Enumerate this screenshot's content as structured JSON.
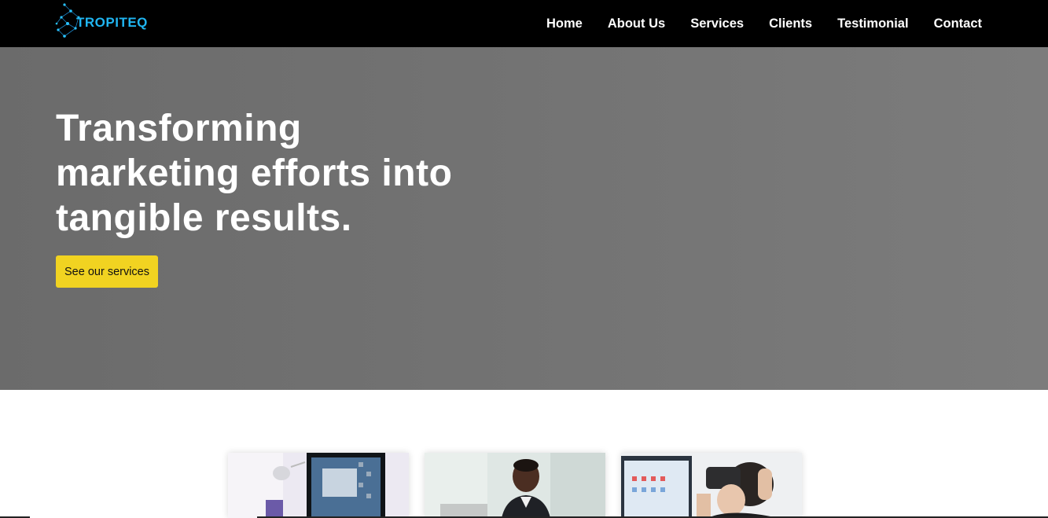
{
  "brand": {
    "name": "TROPITEQ"
  },
  "nav": {
    "items": [
      {
        "label": "Home"
      },
      {
        "label": "About Us"
      },
      {
        "label": "Services"
      },
      {
        "label": "Clients"
      },
      {
        "label": "Testimonial"
      },
      {
        "label": "Contact"
      }
    ]
  },
  "hero": {
    "title_lines": [
      "Transforming",
      "marketing efforts into",
      "tangible results."
    ],
    "cta_label": "See our services"
  },
  "colors": {
    "nav_background": "#000000",
    "hero_background": "#737373",
    "cta_background": "#f1d321",
    "logo_accent": "#20b6f2"
  }
}
